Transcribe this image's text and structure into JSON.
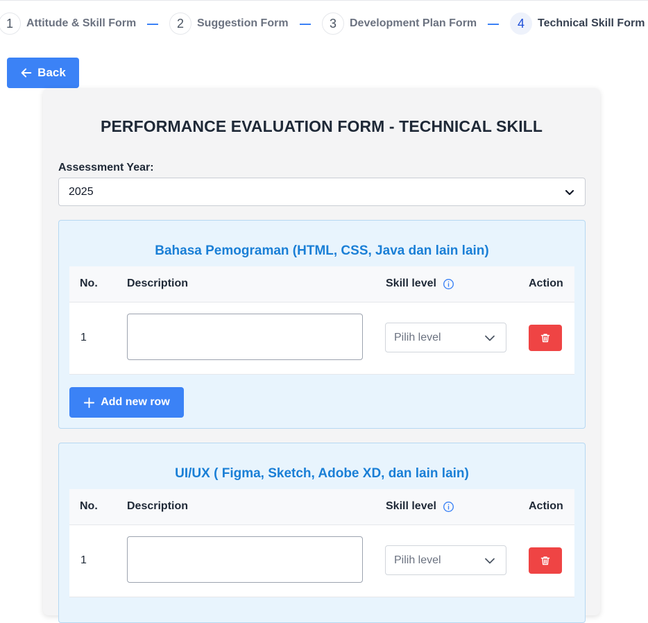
{
  "stepper": {
    "steps": [
      {
        "number": "1",
        "label": "Attitude & Skill Form",
        "active": false
      },
      {
        "number": "2",
        "label": "Suggestion Form",
        "active": false
      },
      {
        "number": "3",
        "label": "Development Plan Form",
        "active": false
      },
      {
        "number": "4",
        "label": "Technical Skill Form",
        "active": true
      }
    ]
  },
  "back_button": {
    "label": "Back",
    "icon": "arrow-left-icon"
  },
  "form": {
    "title": "PERFORMANCE EVALUATION FORM - TECHNICAL SKILL",
    "year_label": "Assessment Year:",
    "year_value": "2025",
    "sections": [
      {
        "title": "Bahasa Pemograman (HTML, CSS, Java dan lain lain)",
        "headers": {
          "no": "No.",
          "description": "Description",
          "skill_level": "Skill level",
          "action": "Action"
        },
        "rows": [
          {
            "no": "1",
            "description": "",
            "level_placeholder": "Pilih level"
          }
        ],
        "add_row_label": "Add new row"
      },
      {
        "title": "UI/UX ( Figma, Sketch, Adobe XD, dan lain lain)",
        "headers": {
          "no": "No.",
          "description": "Description",
          "skill_level": "Skill level",
          "action": "Action"
        },
        "rows": [
          {
            "no": "1",
            "description": "",
            "level_placeholder": "Pilih level"
          }
        ]
      }
    ]
  },
  "colors": {
    "primary": "#3b82f6",
    "danger": "#ef4444",
    "section_title": "#1a7fd6",
    "section_bg": "#e8f4fd"
  }
}
